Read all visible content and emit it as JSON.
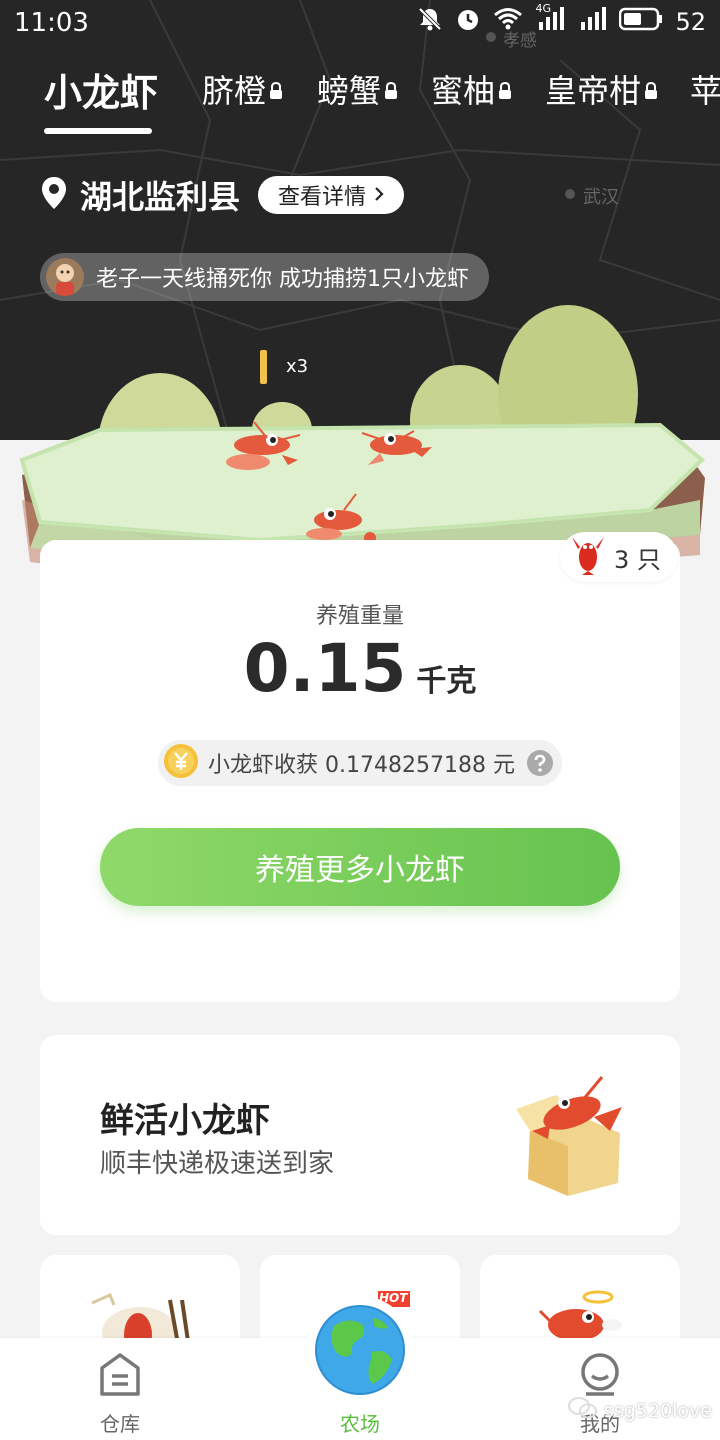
{
  "status_bar": {
    "time": "11:03",
    "network": "4G",
    "battery": "52"
  },
  "tabs": [
    {
      "label": "小龙虾",
      "active": true,
      "locked": false
    },
    {
      "label": "脐橙",
      "active": false,
      "locked": true
    },
    {
      "label": "螃蟹",
      "active": false,
      "locked": true
    },
    {
      "label": "蜜柚",
      "active": false,
      "locked": true
    },
    {
      "label": "皇帝柑",
      "active": false,
      "locked": true
    },
    {
      "label": "苹",
      "active": false,
      "locked": false
    }
  ],
  "map_labels": {
    "city_1": "孝感",
    "city_2": "武汉"
  },
  "location": {
    "title": "湖北监利县",
    "detail_button": "查看详情"
  },
  "ticker": {
    "message": "老子一天线捅死你 成功捕捞1只小龙虾"
  },
  "scene": {
    "coin_multiplier": "x3"
  },
  "stats": {
    "count_label": "3 只",
    "weight_label": "养殖重量",
    "weight_value": "0.15",
    "weight_unit": "千克",
    "harvest_text": "小龙虾收获 0.1748257188 元",
    "cta_label": "养殖更多小龙虾"
  },
  "promo": {
    "title": "鲜活小龙虾",
    "subtitle": "顺丰快递极速送到家"
  },
  "hot_tag": "HOT",
  "bottom_nav": {
    "warehouse": "仓库",
    "farm": "农场",
    "mine": "我的"
  },
  "watermark": "ssg520love",
  "colors": {
    "accent_green": "#66c24e",
    "dark_bg": "#262626",
    "crayfish_red": "#e0402a"
  }
}
